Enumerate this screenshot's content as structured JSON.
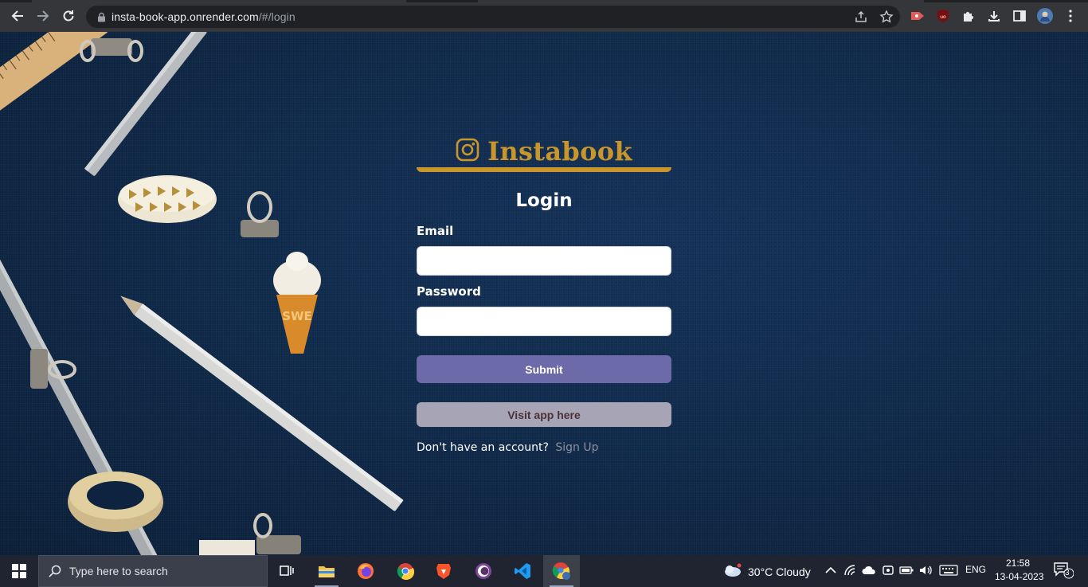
{
  "browser": {
    "url_host": "insta-book-app.onrender.com",
    "url_path": "/#/login"
  },
  "app": {
    "brand_name": "Instabook",
    "brand_color": "#c9962c",
    "form_title": "Login",
    "email_label": "Email",
    "email_value": "",
    "password_label": "Password",
    "password_value": "",
    "submit_label": "Submit",
    "visit_label": "Visit app here",
    "signup_prompt": "Don't have an account?",
    "signup_link": "Sign Up"
  },
  "taskbar": {
    "search_placeholder": "Type here to search",
    "apps": [
      "file-explorer",
      "firefox",
      "chrome",
      "brave",
      "tor-browser",
      "vscode",
      "chrome-profile"
    ],
    "weather": "30°C  Cloudy",
    "language": "ENG",
    "time": "21:58",
    "date": "13-04-2023",
    "notification_count": "3"
  }
}
